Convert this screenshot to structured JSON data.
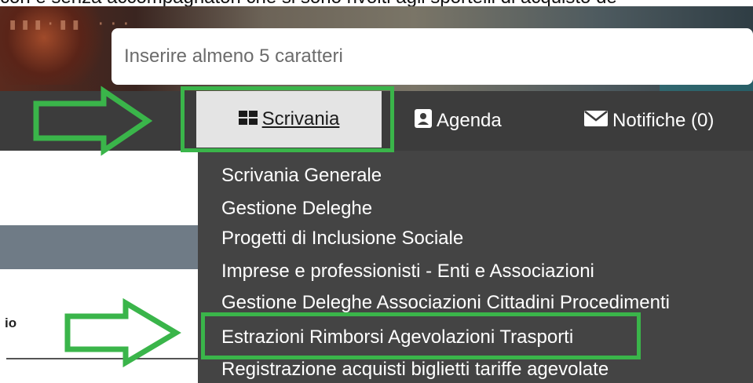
{
  "context": {
    "top_text": "con e senza accompagnatori che si sono rivolti agli sportelli di acquisto de"
  },
  "search": {
    "placeholder": "Inserire almeno 5 caratteri"
  },
  "nav": {
    "scrivania_label": "Scrivania",
    "agenda_label": "Agenda",
    "notifiche_label": "Notifiche (0)"
  },
  "menu": {
    "items": [
      "Scrivania Generale",
      "Gestione Deleghe",
      "Progetti di Inclusione Sociale",
      "Imprese e professionisti - Enti e Associazioni",
      "Gestione Deleghe Associazioni Cittadini Procedimenti",
      "Estrazioni Rimborsi Agevolazioni Trasporti",
      "Registrazione acquisti biglietti tariffe agevolate"
    ]
  },
  "side": {
    "label": "io"
  },
  "colors": {
    "highlight": "#3ab54a",
    "navbar": "#3c3c3c",
    "menu": "#444444"
  }
}
